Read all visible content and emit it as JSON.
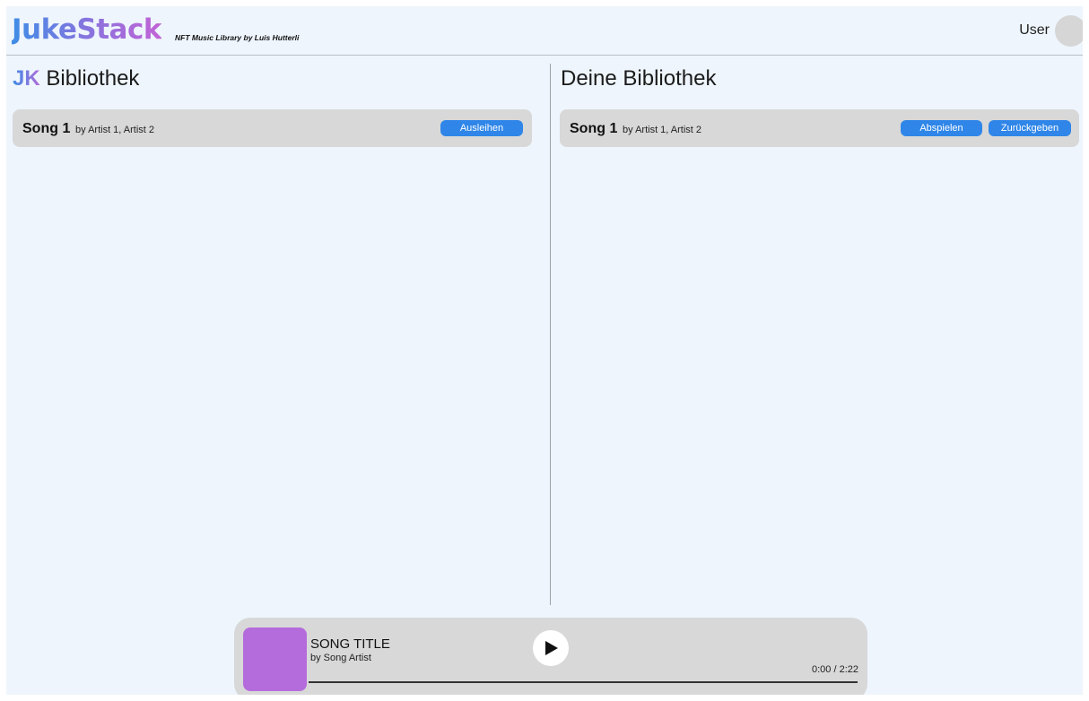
{
  "header": {
    "logo": "JukeStack",
    "subtitle": "NFT Music Library by Luis Hutterli",
    "user_label": "User"
  },
  "library": {
    "title_prefix": "JK",
    "title": "Bibliothek",
    "songs": [
      {
        "title": "Song 1",
        "artists": "by Artist 1, Artist 2",
        "action": "Ausleihen"
      }
    ]
  },
  "my_library": {
    "title": "Deine Bibliothek",
    "songs": [
      {
        "title": "Song 1",
        "artists": "by Artist 1, Artist 2",
        "play": "Abspielen",
        "return": "Zurückgeben"
      }
    ]
  },
  "player": {
    "title": "SONG TITLE",
    "artist": "by Song Artist",
    "time": "0:00 / 2:22",
    "progress": 1.0
  },
  "colors": {
    "accent": "#2f86e8",
    "cover": "#b46cdc",
    "background": "#eef5fd"
  },
  "icons": {
    "play": "play-icon"
  }
}
